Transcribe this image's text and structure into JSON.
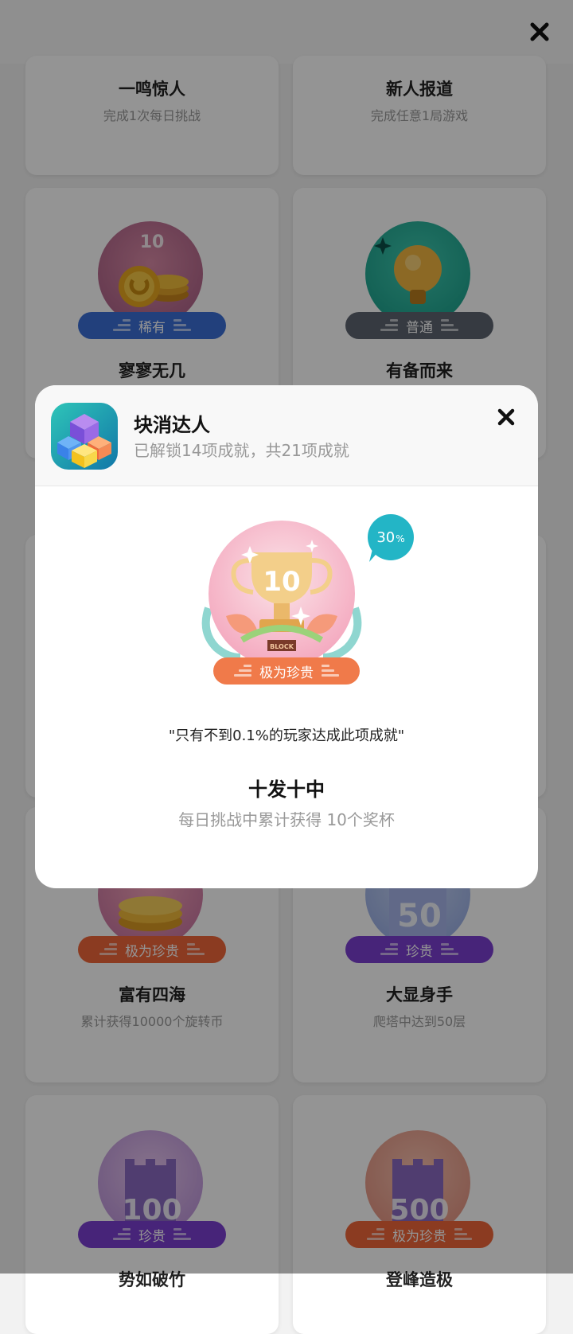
{
  "cards": [
    {
      "title": "一鸣惊人",
      "desc": "完成1次每日挑战"
    },
    {
      "title": "新人报道",
      "desc": "完成任意1局游戏"
    },
    {
      "title": "寥寥无几",
      "badge_number": "10",
      "rarity": "稀有",
      "rarity_color": "#3b6fd6"
    },
    {
      "title": "有备而来",
      "rarity": "普通",
      "rarity_color": "#5d6470"
    },
    {
      "title": "富有四海",
      "desc": "累计获得10000个旋转币",
      "rarity": "极为珍贵",
      "rarity_color": "#f0663a"
    },
    {
      "title": "大显身手",
      "desc": "爬塔中达到50层",
      "badge_number": "50",
      "rarity": "珍贵",
      "rarity_color": "#7b3fd0"
    },
    {
      "title": "势如破竹",
      "badge_number": "100",
      "rarity": "珍贵",
      "rarity_color": "#7b3fd0"
    },
    {
      "title": "登峰造极",
      "badge_number": "500",
      "rarity": "极为珍贵",
      "rarity_color": "#f0663a"
    }
  ],
  "modal": {
    "app_name": "块消达人",
    "progress_text": "已解锁14项成就，共21项成就",
    "badge_number": "10",
    "badge_bottom_text": "BLOCK",
    "rarity": "极为珍贵",
    "rarity_color": "#f07a4a",
    "percent_value": "30",
    "percent_sign": "%",
    "quote": "\"只有不到0.1%的玩家达成此项成就\"",
    "achievement_title": "十发十中",
    "achievement_desc": "每日挑战中累计获得 10个奖杯"
  }
}
